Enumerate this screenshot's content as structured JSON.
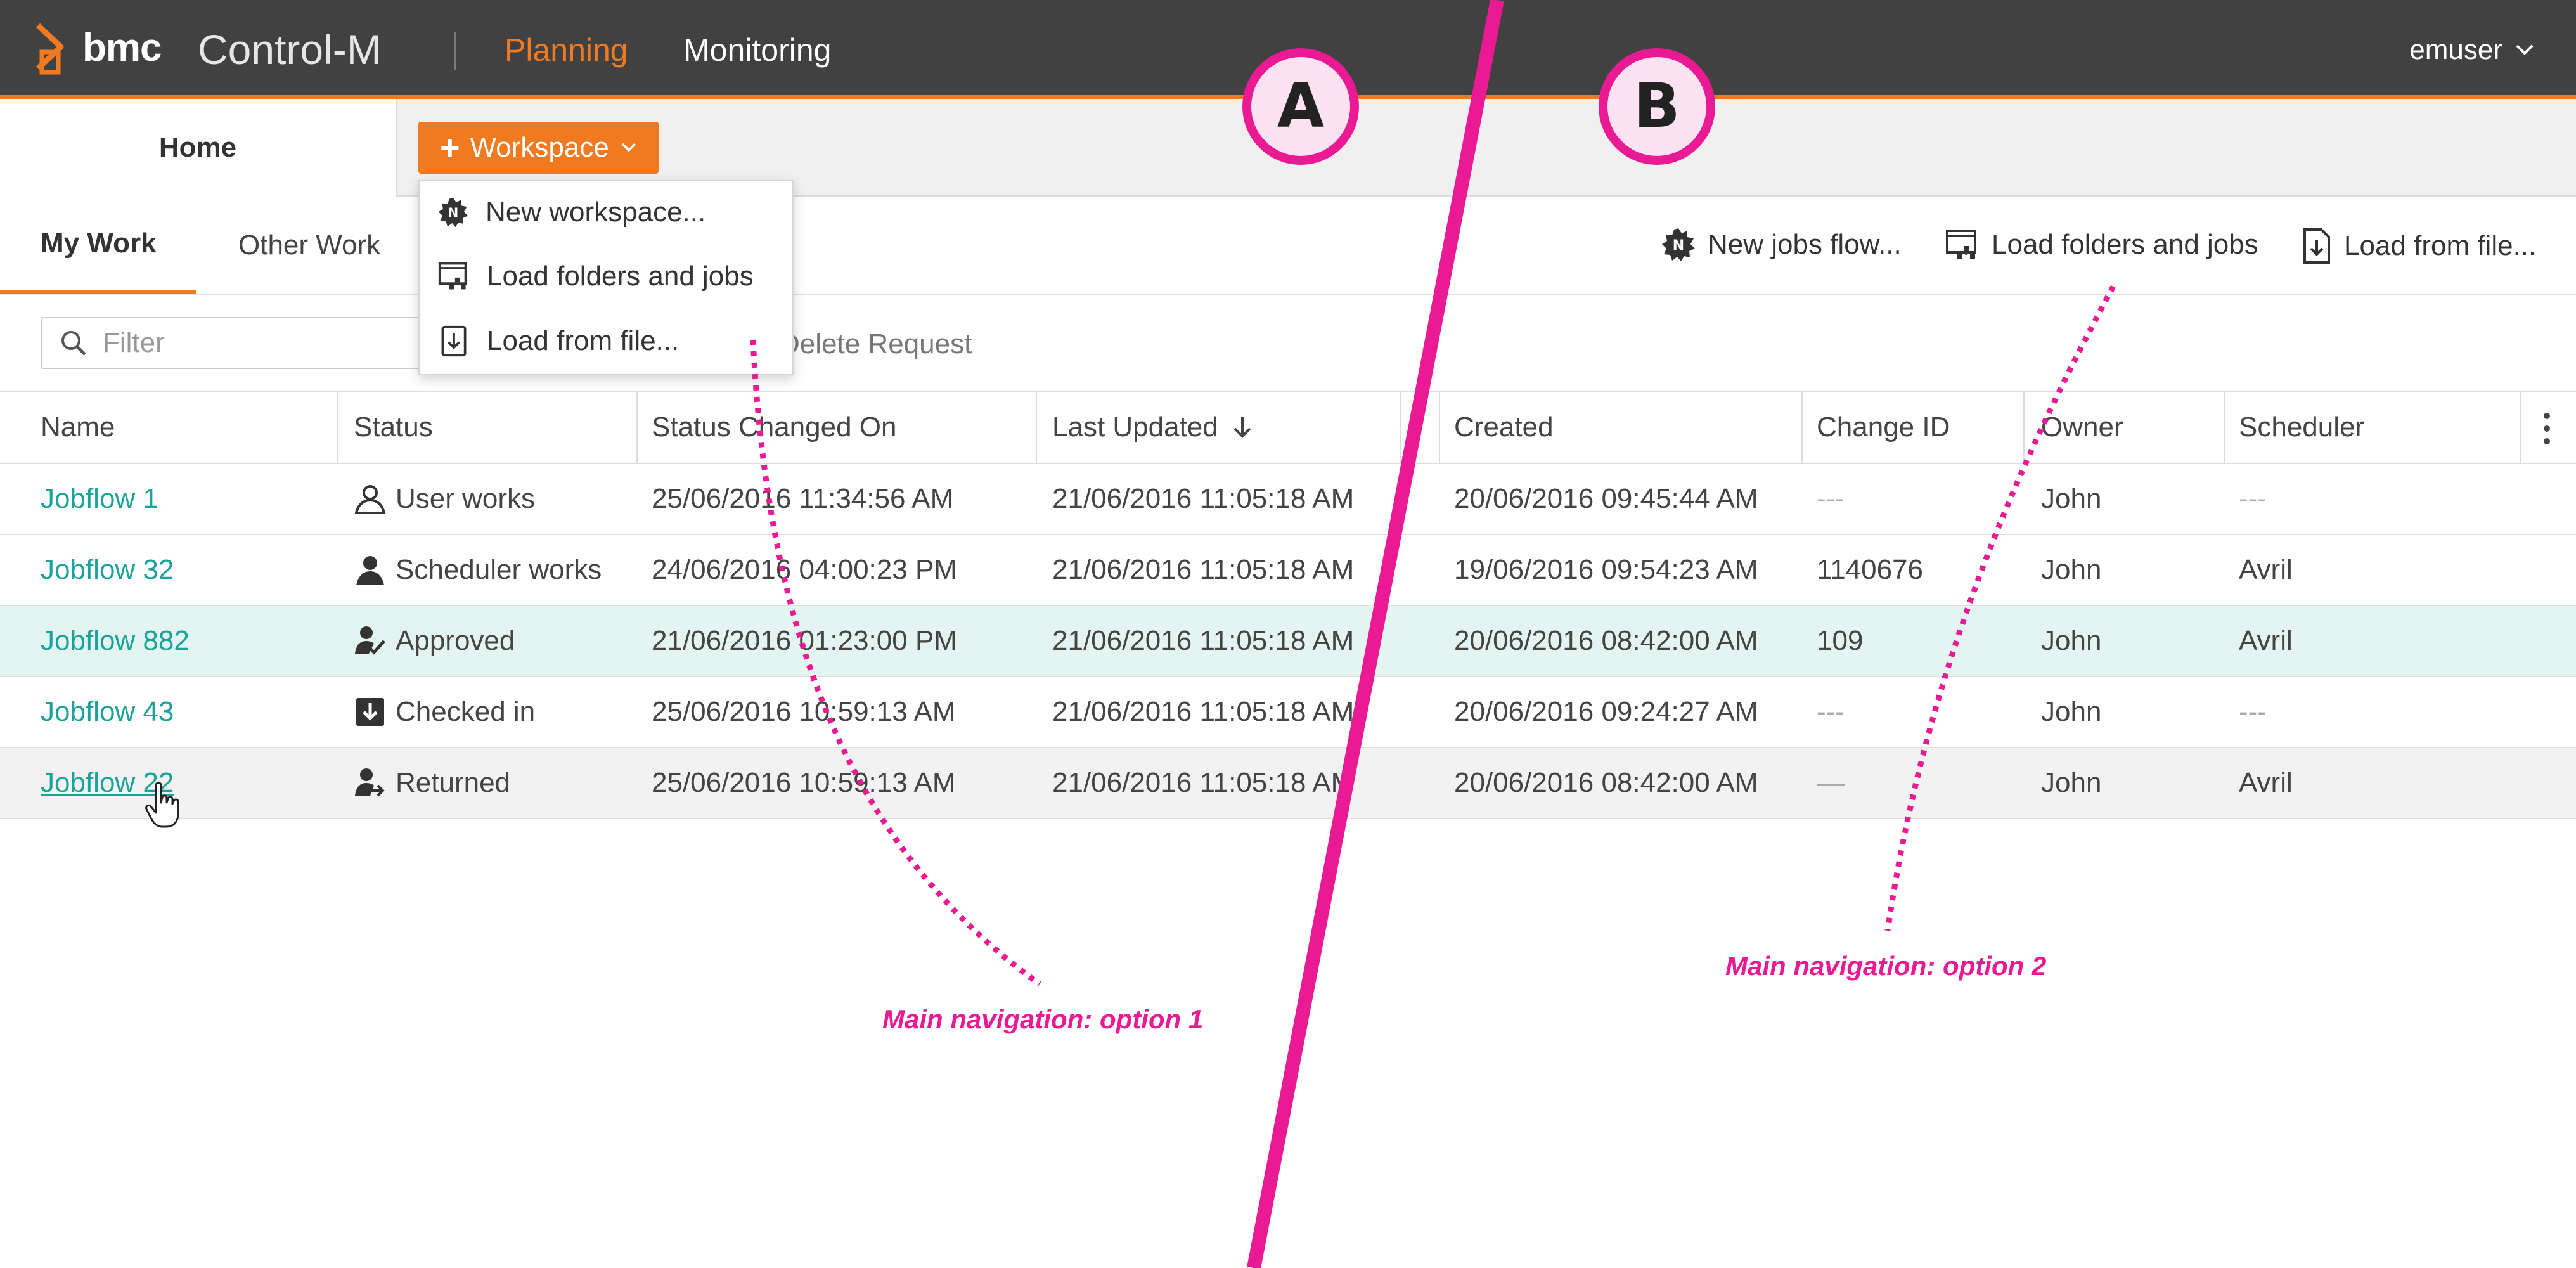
{
  "topbar": {
    "brand": "bmc",
    "product": "Control-M",
    "nav": [
      "Planning",
      "Monitoring"
    ],
    "user": "emuser",
    "accent_color": "#f07a21",
    "bar_color": "#414141"
  },
  "subbar": {
    "home_tab": "Home",
    "workspace_button": "Workspace"
  },
  "workspace_menu": [
    {
      "label": "New workspace...",
      "icon": "new-workspace-icon"
    },
    {
      "label": "Load folders and jobs",
      "icon": "load-folders-icon"
    },
    {
      "label": "Load from file...",
      "icon": "load-file-icon"
    }
  ],
  "worktabs": {
    "tabs": [
      "My Work",
      "Other Work"
    ],
    "active": "My Work",
    "actions": [
      "New jobs flow...",
      "Load folders and jobs",
      "Load from file..."
    ]
  },
  "filter": {
    "placeholder": "Filter",
    "delete_request": "Delete Request"
  },
  "table": {
    "columns": [
      "Name",
      "Status",
      "Status Changed On",
      "Last Updated",
      "Created",
      "Change ID",
      "Owner",
      "Scheduler"
    ],
    "sorted_column": "Last Updated",
    "sort_direction": "descending",
    "rows": [
      {
        "name": "Jobflow 1",
        "status": "User works",
        "status_icon": "user-outline-icon",
        "status_changed_on": "25/06/2016 11:34:56 AM",
        "last_updated": "21/06/2016 11:05:18 AM",
        "created": "20/06/2016 09:45:44 AM",
        "change_id": "---",
        "owner": "John",
        "scheduler": "---"
      },
      {
        "name": "Jobflow 32",
        "status": "Scheduler works",
        "status_icon": "user-solid-icon",
        "status_changed_on": "24/06/2016 04:00:23 PM",
        "last_updated": "21/06/2016 11:05:18 AM",
        "created": "19/06/2016 09:54:23 AM",
        "change_id": "1140676",
        "owner": "John",
        "scheduler": "Avril"
      },
      {
        "name": "Jobflow 882",
        "status": "Approved",
        "status_icon": "user-check-icon",
        "status_changed_on": "21/06/2016 01:23:00 PM",
        "last_updated": "21/06/2016 11:05:18 AM",
        "created": "20/06/2016 08:42:00 AM",
        "change_id": "109",
        "owner": "John",
        "scheduler": "Avril"
      },
      {
        "name": "Jobflow 43",
        "status": "Checked in",
        "status_icon": "check-in-icon",
        "status_changed_on": "25/06/2016 10:59:13 AM",
        "last_updated": "21/06/2016 11:05:18 AM",
        "created": "20/06/2016 09:24:27 AM",
        "change_id": "---",
        "owner": "John",
        "scheduler": "---"
      },
      {
        "name": "Jobflow 22",
        "status": "Returned",
        "status_icon": "user-return-icon",
        "status_changed_on": "25/06/2016 10:59:13 AM",
        "last_updated": "21/06/2016 11:05:18 AM",
        "created": "20/06/2016 08:42:00 AM",
        "change_id": "—",
        "owner": "John",
        "scheduler": "Avril"
      }
    ]
  },
  "annotations": {
    "marker_a": "A",
    "marker_b": "B",
    "note_option_1": "Main navigation: option 1",
    "note_option_2": "Main navigation: option 2",
    "color": "#ea1a95"
  }
}
